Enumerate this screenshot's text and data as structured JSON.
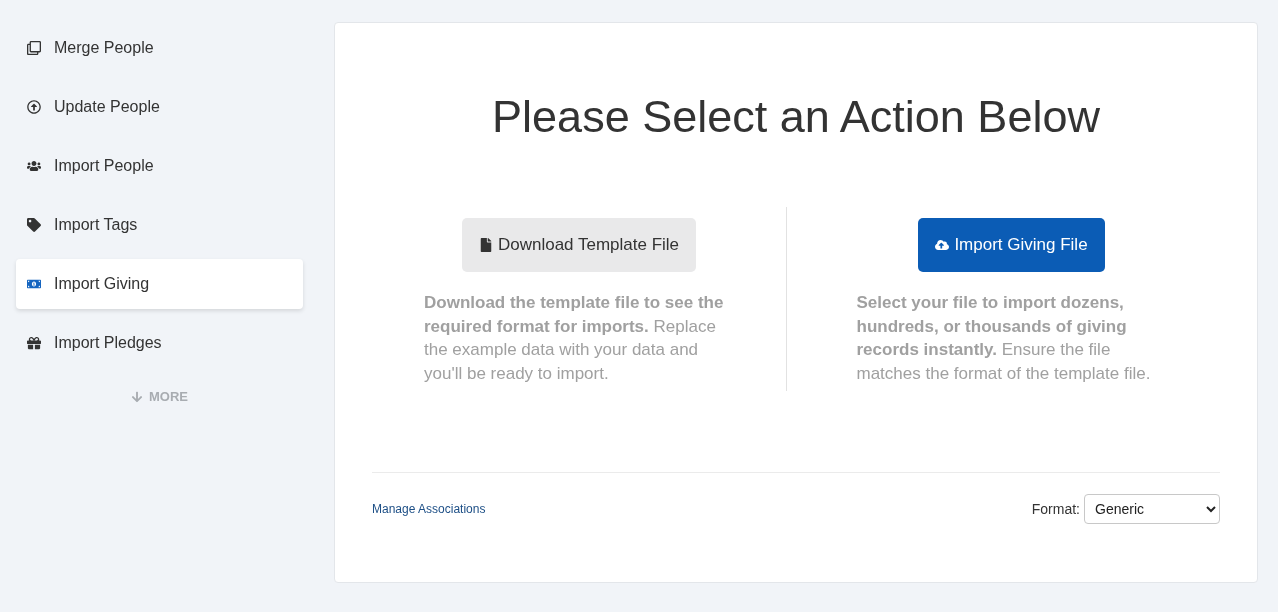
{
  "sidebar": {
    "items": [
      {
        "label": "Merge People",
        "selected": false
      },
      {
        "label": "Update People",
        "selected": false
      },
      {
        "label": "Import People",
        "selected": false
      },
      {
        "label": "Import Tags",
        "selected": false
      },
      {
        "label": "Import Giving",
        "selected": true
      },
      {
        "label": "Import Pledges",
        "selected": false
      }
    ],
    "more": {
      "label": "MORE"
    }
  },
  "main": {
    "title": "Please Select an Action Below",
    "actions": [
      {
        "kind": "secondary",
        "button": "Download Template File",
        "description": "**Download the template file to see the required format for imports.** Replace the example data with your data and you'll be ready to import."
      },
      {
        "kind": "primary",
        "button": "Import Giving File",
        "description": "**Select your file to import dozens, hundreds, or thousands of giving records instantly.** Ensure the file matches the format of the template file."
      }
    ],
    "footer": {
      "link": "Manage Associations",
      "format": {
        "label": "Format:",
        "value": "Generic"
      }
    }
  }
}
